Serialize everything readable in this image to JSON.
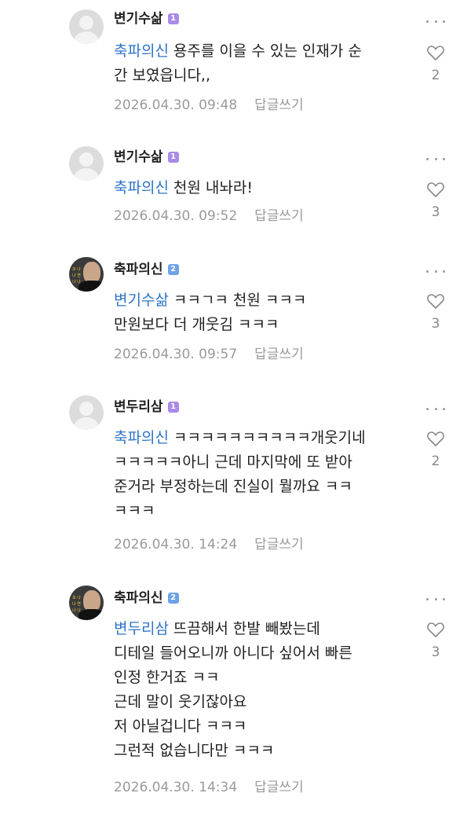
{
  "comments": [
    {
      "nickname": "변기수삶",
      "level": "1",
      "mention": "축파의신",
      "lines": [
        "용주를 이을 수 있는 인재가 순",
        "간 보였읍니다,,"
      ],
      "date": "2026.04.30. 09:48",
      "reply_label": "답글쓰기",
      "likes": "2"
    },
    {
      "nickname": "변기수삶",
      "level": "1",
      "mention": "축파의신",
      "lines": [
        "천원 내놔라!"
      ],
      "date": "2026.04.30. 09:52",
      "reply_label": "답글쓰기",
      "likes": "3"
    },
    {
      "nickname": "축파의신",
      "level": "2",
      "mention": "변기수삶",
      "lines": [
        "ㅋㅋㄱㅋ 천원 ㅋㅋㅋ",
        "만원보다 더 개웃김 ㅋㅋㅋ"
      ],
      "date": "2026.04.30. 09:57",
      "reply_label": "답글쓰기",
      "likes": "3"
    },
    {
      "nickname": "변두리삼",
      "level": "1",
      "mention": "축파의신",
      "lines": [
        "ㅋㅋㅋㅋㅋㅋㅋㅋㅋㅋ개웃기네",
        "ㅋㅋㅋㅋㅋ아니 근데 마지막에 또 받아",
        "준거라 부정하는데 진실이 뭘까요 ㅋㅋ",
        "ㅋㅋㅋ"
      ],
      "date": "2026.04.30. 14:24",
      "reply_label": "답글쓰기",
      "likes": "2"
    },
    {
      "nickname": "축파의신",
      "level": "2",
      "mention": "변두리삼",
      "lines": [
        "뜨끔해서 한발 빼봤는데",
        "디테일 들어오니까 아니다 싶어서 빠른",
        "인정 한거죠 ㅋㅋ",
        "근데 말이 웃기잖아요",
        "저 아닐겁니다 ㅋㅋㅋ",
        "그런적 없습니다만 ㅋㅋㅋ"
      ],
      "date": "2026.04.30. 14:34",
      "reply_label": "답글쓰기",
      "likes": "3"
    }
  ],
  "avatar_text": "조 나 나 연 나 나",
  "colors": {
    "mention": "#2d74c8",
    "level1": "#a98ae8",
    "level2": "#6fa2e8",
    "meta": "#9a9a9a"
  }
}
